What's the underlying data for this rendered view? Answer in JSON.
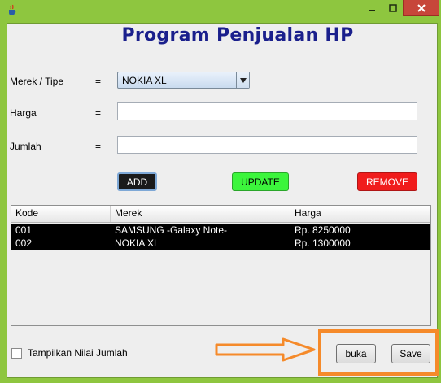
{
  "window": {
    "title": ""
  },
  "header": {
    "title": "Program Penjualan HP"
  },
  "form": {
    "merek_label": "Merek / Tipe",
    "harga_label": "Harga",
    "jumlah_label": "Jumlah",
    "equals": "=",
    "merek_selected": "NOKIA XL",
    "harga_value": "",
    "jumlah_value": ""
  },
  "actions": {
    "add": "ADD",
    "update": "UPDATE",
    "remove": "REMOVE"
  },
  "table": {
    "columns": [
      "Kode",
      "Merek",
      "Harga"
    ],
    "rows": [
      [
        "001",
        "SAMSUNG -Galaxy Note-",
        "Rp. 8250000"
      ],
      [
        "002",
        "NOKIA XL",
        "Rp. 1300000"
      ]
    ]
  },
  "footer": {
    "checkbox_label": "Tampilkan Nilai Jumlah",
    "buka": "buka",
    "save": "Save"
  },
  "colors": {
    "window_frame": "#8ec63f",
    "title_text": "#1a1f8c",
    "add_button": "#1a1a1a",
    "update_button": "#3cf53c",
    "remove_button": "#f01c1c",
    "highlight": "#f58a2a"
  },
  "icons": {
    "app": "java-cup-icon",
    "minimize": "minimize-icon",
    "maximize": "maximize-icon",
    "close": "close-icon",
    "dropdown": "chevron-down-icon",
    "annotation": "arrow-right-icon"
  }
}
